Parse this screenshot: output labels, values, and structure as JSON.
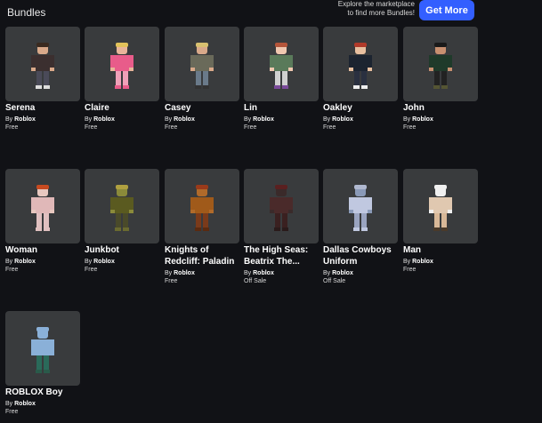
{
  "header": {
    "title": "Bundles",
    "promo_line1": "Explore the marketplace",
    "promo_line2": "to find more Bundles!",
    "get_more_label": "Get More"
  },
  "bundles": [
    {
      "name": "Serena",
      "by": "By",
      "creator": "Roblox",
      "price": "Free",
      "icon": "avatar-serena"
    },
    {
      "name": "Claire",
      "by": "By",
      "creator": "Roblox",
      "price": "Free",
      "icon": "avatar-claire"
    },
    {
      "name": "Casey",
      "by": "By",
      "creator": "Roblox",
      "price": "Free",
      "icon": "avatar-casey"
    },
    {
      "name": "Lin",
      "by": "By",
      "creator": "Roblox",
      "price": "Free",
      "icon": "avatar-lin"
    },
    {
      "name": "Oakley",
      "by": "By",
      "creator": "Roblox",
      "price": "Free",
      "icon": "avatar-oakley"
    },
    {
      "name": "John",
      "by": "By",
      "creator": "Roblox",
      "price": "Free",
      "icon": "avatar-john"
    },
    {
      "name": "Woman",
      "by": "By",
      "creator": "Roblox",
      "price": "Free",
      "icon": "avatar-woman"
    },
    {
      "name": "Junkbot",
      "by": "By",
      "creator": "Roblox",
      "price": "Free",
      "icon": "avatar-junkbot"
    },
    {
      "name": "Knights of Redcliff: Paladin",
      "by": "By",
      "creator": "Roblox",
      "price": "Free",
      "icon": "avatar-paladin"
    },
    {
      "name": "The High Seas: Beatrix The...",
      "by": "By",
      "creator": "Roblox",
      "price": "Off Sale",
      "icon": "avatar-beatrix"
    },
    {
      "name": "Dallas Cowboys Uniform",
      "by": "By",
      "creator": "Roblox",
      "price": "Off Sale",
      "icon": "avatar-cowboys"
    },
    {
      "name": "Man",
      "by": "By",
      "creator": "Roblox",
      "price": "Free",
      "icon": "avatar-man"
    },
    {
      "name": "ROBLOX Boy",
      "by": "By",
      "creator": "Roblox",
      "price": "Free",
      "icon": "avatar-roblox-boy"
    }
  ],
  "colors": {
    "background": "#111216",
    "card": "#393b3d",
    "accent": "#335fff"
  }
}
